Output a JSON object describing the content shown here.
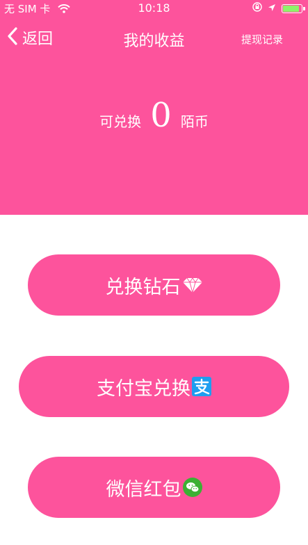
{
  "status_bar": {
    "carrier": "无 SIM 卡",
    "time": "10:18",
    "battery_level": 0.9
  },
  "nav": {
    "back_label": "返回",
    "title": "我的收益",
    "right_action": "提现记录"
  },
  "balance": {
    "label": "可兑换",
    "value": "0",
    "unit": "陌币"
  },
  "actions": [
    {
      "label": "兑换钻石",
      "icon": "diamond-icon"
    },
    {
      "label": "支付宝兑换",
      "icon": "alipay-icon"
    },
    {
      "label": "微信红包",
      "icon": "wechat-icon"
    }
  ],
  "colors": {
    "primary": "#fd539c",
    "background": "#ffffff",
    "text_on_primary": "#ffffff"
  }
}
